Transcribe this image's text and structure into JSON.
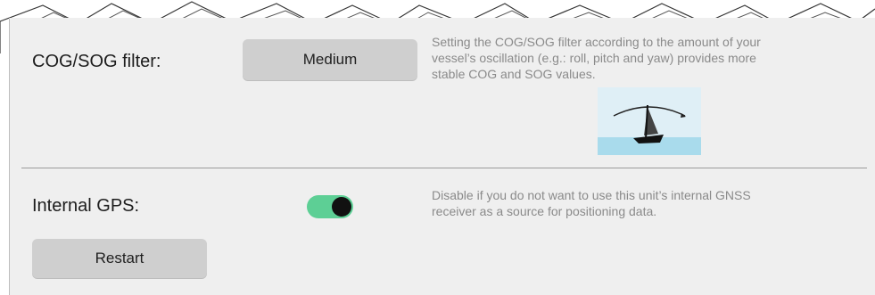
{
  "cog_sog": {
    "label": "COG/SOG filter:",
    "value": "Medium",
    "description_lines": [
      "Setting the COG/SOG filter according to the amount of your",
      "vessel’s oscillation (e.g.: roll, pitch and yaw) provides more",
      "stable COG and SOG values."
    ]
  },
  "internal_gps": {
    "label": "Internal GPS:",
    "enabled": true,
    "description_lines": [
      "Disable if you do not want to use this unit’s internal GNSS",
      "receiver as a source for positioning data."
    ]
  },
  "restart": {
    "label": "Restart"
  },
  "colors": {
    "panel": "#efefef",
    "toggle_on": "#5dcf95",
    "button": "#cfcfcf",
    "water": "#a9dbec",
    "sky": "#dfeff6"
  },
  "icons": {
    "oscillation_illustration": "sailboat-roll-icon"
  }
}
